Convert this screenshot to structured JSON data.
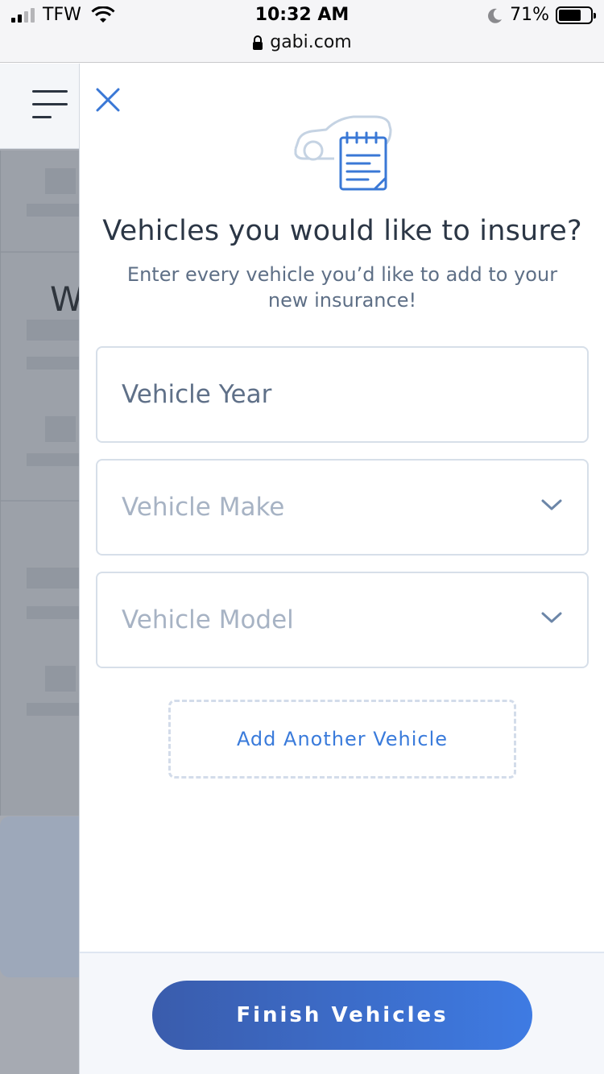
{
  "status_bar": {
    "carrier": "TFW",
    "time": "10:32 AM",
    "url": "gabi.com",
    "battery": "71%"
  },
  "background_page": {
    "partial_heading": "W"
  },
  "panel": {
    "heading": "Vehicles you would like to insure?",
    "subtext": "Enter every vehicle you’d like to add to your new insurance!",
    "fields": {
      "year_placeholder": "Vehicle Year",
      "make_label": "Vehicle Make",
      "model_label": "Vehicle Model"
    },
    "add_vehicle_label": "Add Another Vehicle",
    "finish_label": "Finish Vehicles"
  },
  "colors": {
    "accent": "#3a7bdb",
    "button_start": "#3a5cac",
    "button_end": "#3e7be3"
  }
}
